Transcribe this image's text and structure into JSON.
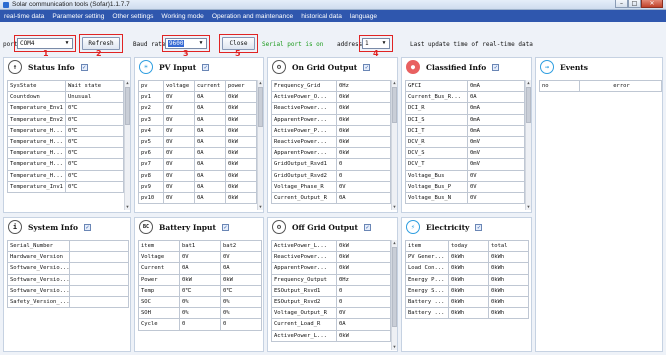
{
  "window": {
    "title": "Solar communication tools (Sofar)1.1.7.7",
    "min": "–",
    "max": "□",
    "close": "✕"
  },
  "menu": [
    "real-time data",
    "Parameter setting",
    "Other settings",
    "Working mode",
    "Operation and maintenance",
    "historical data",
    "language"
  ],
  "toolbar": {
    "port_label": "port",
    "port_value": "COM4",
    "refresh_label": "Refresh",
    "baud_label": "Baud rate",
    "baud_value": "9600",
    "close_label": "Close",
    "serial_status": "Serial port is on",
    "address_label": "address",
    "address_value": "1",
    "last_update": "Last update time of real-time data"
  },
  "markers": [
    "1",
    "2",
    "3",
    "4",
    "5"
  ],
  "panels": {
    "status": {
      "title": "Status Info",
      "icon": "↑",
      "rows": [
        [
          "SysState",
          "Wait state"
        ],
        [
          "Countdown",
          "Unusual"
        ],
        [
          "Temperature_Env1",
          "0℃"
        ],
        [
          "Temperature_Env2",
          "0℃"
        ],
        [
          "Temperature_H...",
          "0℃"
        ],
        [
          "Temperature_H...",
          "0℃"
        ],
        [
          "Temperature_H...",
          "0℃"
        ],
        [
          "Temperature_H...",
          "0℃"
        ],
        [
          "Temperature_H...",
          "0℃"
        ],
        [
          "Temperature_Inv1",
          "0℃"
        ]
      ]
    },
    "pv": {
      "title": "PV Input",
      "icon": "☀",
      "header": [
        "pv",
        "voltage",
        "current",
        "power"
      ],
      "rows": [
        [
          "pv1",
          "0V",
          "0A",
          "0kW"
        ],
        [
          "pv2",
          "0V",
          "0A",
          "0kW"
        ],
        [
          "pv3",
          "0V",
          "0A",
          "0kW"
        ],
        [
          "pv4",
          "0V",
          "0A",
          "0kW"
        ],
        [
          "pv5",
          "0V",
          "0A",
          "0kW"
        ],
        [
          "pv6",
          "0V",
          "0A",
          "0kW"
        ],
        [
          "pv7",
          "0V",
          "0A",
          "0kW"
        ],
        [
          "pv8",
          "0V",
          "0A",
          "0kW"
        ],
        [
          "pv9",
          "0V",
          "0A",
          "0kW"
        ],
        [
          "pv10",
          "0V",
          "0A",
          "0kW"
        ]
      ]
    },
    "grid": {
      "title": "On Grid Output",
      "icon": "⚙",
      "rows": [
        [
          "Frequency_Grid",
          "0Hz"
        ],
        [
          "ActivePower_O...",
          "0kW"
        ],
        [
          "ReactivePower...",
          "0kW"
        ],
        [
          "ApparentPower...",
          "0kW"
        ],
        [
          "ActivePower_P...",
          "0kW"
        ],
        [
          "ReactivePower...",
          "0kW"
        ],
        [
          "ApparentPower...",
          "0kW"
        ],
        [
          "GridOutput_Rsvd1",
          "0"
        ],
        [
          "GridOutput_Rsvd2",
          "0"
        ],
        [
          "Voltage_Phase_R",
          "0V"
        ],
        [
          "Current_Output_R",
          "0A"
        ]
      ]
    },
    "classified": {
      "title": "Classified Info",
      "icon": "●",
      "rows": [
        [
          "GFCI",
          "0mA"
        ],
        [
          "Current_Bus_R...",
          "0A"
        ],
        [
          "DCI_R",
          "0mA"
        ],
        [
          "DCI_S",
          "0mA"
        ],
        [
          "DCI_T",
          "0mA"
        ],
        [
          "DCV_R",
          "0mV"
        ],
        [
          "DCV_S",
          "0mV"
        ],
        [
          "DCV_T",
          "0mV"
        ],
        [
          "Voltage_Bus",
          "0V"
        ],
        [
          "Voltage_Bus_P",
          "0V"
        ],
        [
          "Voltage_Bus_N",
          "0V"
        ]
      ]
    },
    "events": {
      "title": "Events",
      "icon": "→",
      "header": [
        "no",
        "error"
      ]
    },
    "system": {
      "title": "System Info",
      "icon": "i",
      "rows": [
        [
          "Serial_Number",
          ""
        ],
        [
          "Hardware_Version",
          ""
        ],
        [
          "Software_Versio...",
          ""
        ],
        [
          "Software_Versio...",
          ""
        ],
        [
          "Software_Versio...",
          ""
        ],
        [
          "Safety_Version_...",
          ""
        ]
      ]
    },
    "battery": {
      "title": "Battery Input",
      "icon": "BC",
      "header": [
        "item",
        "bat1",
        "bat2"
      ],
      "rows": [
        [
          "Voltage",
          "0V",
          "0V"
        ],
        [
          "Current",
          "0A",
          "0A"
        ],
        [
          "Power",
          "0kW",
          "0kW"
        ],
        [
          "Temp",
          "0℃",
          "0℃"
        ],
        [
          "SOC",
          "0%",
          "0%"
        ],
        [
          "SOH",
          "0%",
          "0%"
        ],
        [
          "Cycle",
          "0",
          "0"
        ]
      ]
    },
    "offgrid": {
      "title": "Off Grid Output",
      "icon": "⚙",
      "rows": [
        [
          "ActivePower_L...",
          "0kW"
        ],
        [
          "ReactivePower...",
          "0kW"
        ],
        [
          "ApparentPower...",
          "0kW"
        ],
        [
          "Frequency_Output",
          "0Hz"
        ],
        [
          "ESOutput_Rsvd1",
          "0"
        ],
        [
          "ESOutput_Rsvd2",
          "0"
        ],
        [
          "Voltage_Output_R",
          "0V"
        ],
        [
          "Current_Load_R",
          "0A"
        ],
        [
          "ActivePower_L...",
          "0kW"
        ]
      ]
    },
    "electricity": {
      "title": "Electricity",
      "icon": "⚡",
      "header": [
        "item",
        "today",
        "total"
      ],
      "rows": [
        [
          "PV Gener...",
          "0kWh",
          "0kWh"
        ],
        [
          "Load Con...",
          "0kWh",
          "0kWh"
        ],
        [
          "Energy P...",
          "0kWh",
          "0kWh"
        ],
        [
          "Energy S...",
          "0kWh",
          "0kWh"
        ],
        [
          "Battery ...",
          "0kWh",
          "0kWh"
        ],
        [
          "Battery ...",
          "0kWh",
          "0kWh"
        ]
      ]
    }
  }
}
